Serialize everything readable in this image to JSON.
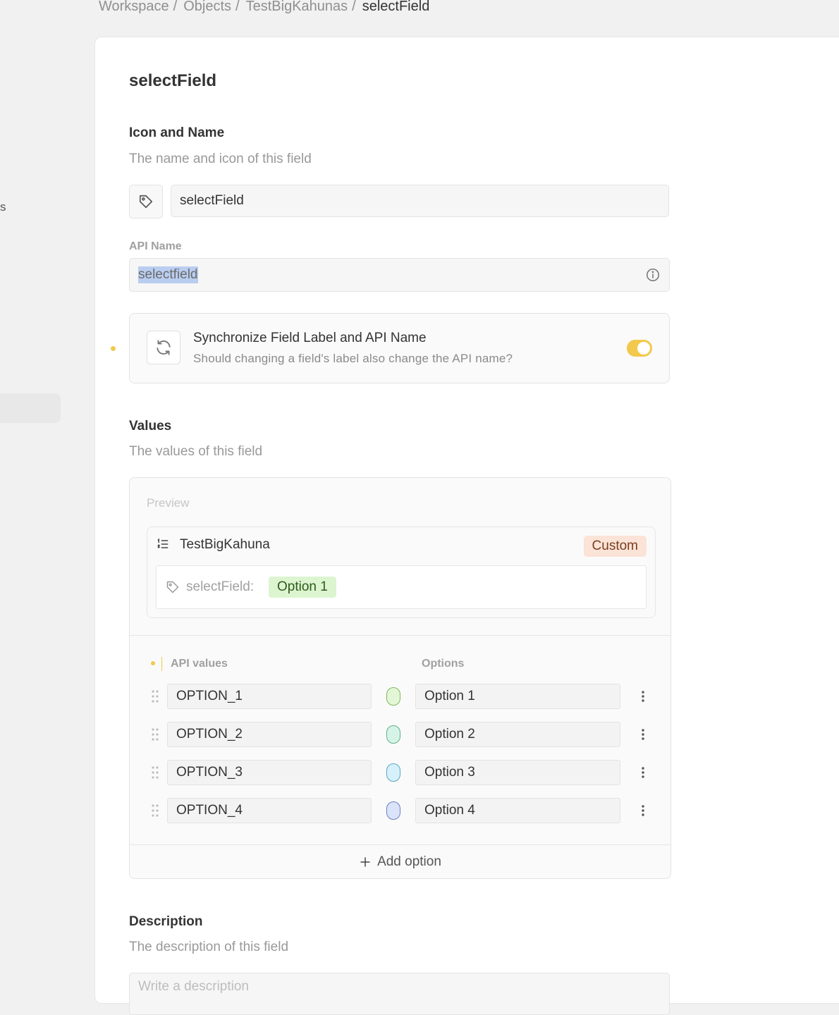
{
  "sidebar": {
    "fragment_text": "s"
  },
  "breadcrumb": {
    "items": [
      "Workspace",
      "Objects",
      "TestBigKahunas"
    ],
    "separator": "/",
    "current": "selectField"
  },
  "page": {
    "title": "selectField"
  },
  "icon_and_name": {
    "title": "Icon and Name",
    "description": "The name and icon of this field",
    "icon": "tag-icon",
    "name_value": "selectField"
  },
  "api_name": {
    "label": "API Name",
    "value": "selectfield",
    "info_icon": "info-icon"
  },
  "sync": {
    "icon": "refresh-icon",
    "title": "Synchronize Field Label and API Name",
    "description": "Should changing a field's label also change the API name?",
    "enabled": true,
    "accent_color": "#f2c94c"
  },
  "values": {
    "title": "Values",
    "description": "The values of this field",
    "preview_label": "Preview",
    "preview": {
      "object_icon": "list-numbers-icon",
      "object_name": "TestBigKahuna",
      "badge": "Custom",
      "field_icon": "tag-icon",
      "field_label": "selectField:",
      "selected_option": "Option 1"
    },
    "headers": {
      "api_values": "API values",
      "options": "Options"
    },
    "options": [
      {
        "api_value": "OPTION_1",
        "label": "Option 1",
        "color": "green",
        "fill": "#e3f7d6",
        "border": "#7fb75e"
      },
      {
        "api_value": "OPTION_2",
        "label": "Option 2",
        "color": "turquoise",
        "fill": "#d6f4e6",
        "border": "#5fb08a"
      },
      {
        "api_value": "OPTION_3",
        "label": "Option 3",
        "color": "sky",
        "fill": "#d6f1fb",
        "border": "#5aa7c6"
      },
      {
        "api_value": "OPTION_4",
        "label": "Option 4",
        "color": "blue",
        "fill": "#dbe3fb",
        "border": "#6b7fc4"
      }
    ],
    "add_option_label": "Add option"
  },
  "description_section": {
    "title": "Description",
    "description": "The description of this field",
    "placeholder": "Write a description"
  }
}
